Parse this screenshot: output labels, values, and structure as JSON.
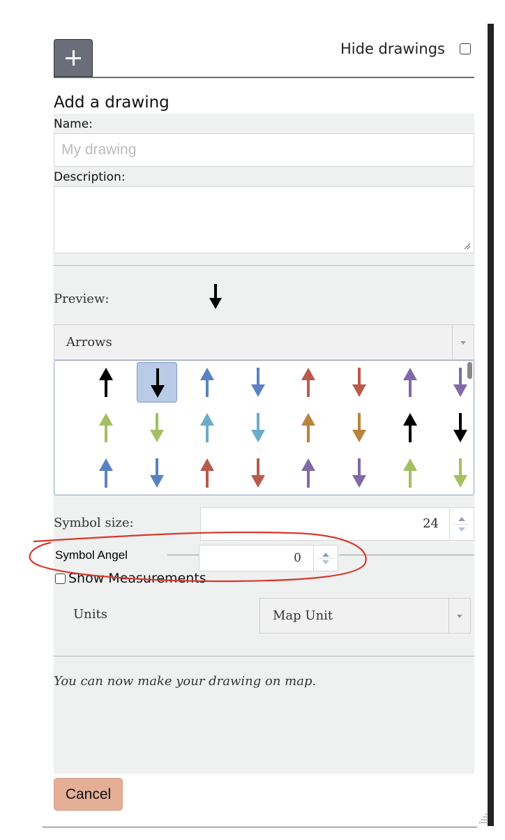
{
  "header": {
    "hide_drawings_label": "Hide drawings",
    "hide_drawings_checked": false,
    "add_icon": "plus-icon"
  },
  "form": {
    "title": "Add a drawing",
    "name_label": "Name:",
    "name_placeholder": "My drawing",
    "name_value": "",
    "description_label": "Description:",
    "description_value": "",
    "preview_label": "Preview:",
    "preview_icon": "arrow-down-icon",
    "preview_color": "#000000",
    "symbol_category": "Arrows",
    "symbols": [
      {
        "dir": "up",
        "color": "#000000",
        "selected": false
      },
      {
        "dir": "down",
        "color": "#000000",
        "selected": true
      },
      {
        "dir": "up",
        "color": "#5b82c0",
        "selected": false
      },
      {
        "dir": "down",
        "color": "#5b82c0",
        "selected": false
      },
      {
        "dir": "up",
        "color": "#b85a4c",
        "selected": false
      },
      {
        "dir": "down",
        "color": "#b85a4c",
        "selected": false
      },
      {
        "dir": "up",
        "color": "#8069a8",
        "selected": false
      },
      {
        "dir": "down",
        "color": "#8069a8",
        "selected": false
      },
      {
        "dir": "up",
        "color": "#a4bf62",
        "selected": false
      },
      {
        "dir": "down",
        "color": "#a4bf62",
        "selected": false
      },
      {
        "dir": "up",
        "color": "#6bacc9",
        "selected": false
      },
      {
        "dir": "down",
        "color": "#6bacc9",
        "selected": false
      },
      {
        "dir": "up",
        "color": "#b8823f",
        "selected": false
      },
      {
        "dir": "down",
        "color": "#b8823f",
        "selected": false
      },
      {
        "dir": "up",
        "color": "#000000",
        "selected": false
      },
      {
        "dir": "down",
        "color": "#000000",
        "selected": false
      },
      {
        "dir": "up",
        "color": "#5b82c0",
        "selected": false
      },
      {
        "dir": "down",
        "color": "#5b82c0",
        "selected": false
      },
      {
        "dir": "up",
        "color": "#b85a4c",
        "selected": false
      },
      {
        "dir": "down",
        "color": "#b85a4c",
        "selected": false
      },
      {
        "dir": "up",
        "color": "#8069a8",
        "selected": false
      },
      {
        "dir": "down",
        "color": "#8069a8",
        "selected": false
      },
      {
        "dir": "up",
        "color": "#a4bf62",
        "selected": false
      },
      {
        "dir": "down",
        "color": "#a4bf62",
        "selected": false
      }
    ],
    "symbol_size_label": "Symbol size:",
    "symbol_size_value": "24",
    "symbol_angle_label": "Symbol Angel",
    "symbol_angle_value": "0",
    "show_measurements_label": "Show Measurements",
    "show_measurements_checked": false,
    "units_label": "Units",
    "units_value": "Map Unit",
    "hint": "You can now make your drawing on map.",
    "cancel_label": "Cancel"
  },
  "annotation": {
    "color": "#d6382b"
  },
  "colors": {
    "panel_bg": "#eff0f0",
    "add_button": "#6b6e7a",
    "cancel_button": "#e4ae97",
    "selected_symbol": "#b9cbe6"
  }
}
